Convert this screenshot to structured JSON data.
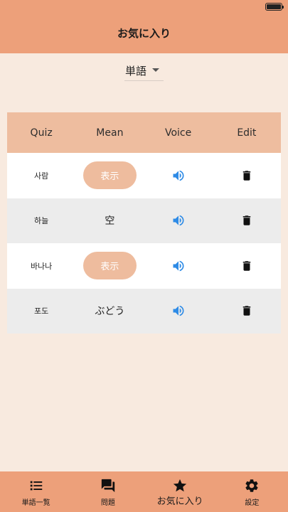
{
  "header": {
    "title": "お気に入り"
  },
  "filter": {
    "selected": "単語"
  },
  "table": {
    "columns": [
      "Quiz",
      "Mean",
      "Voice",
      "Edit"
    ],
    "rows": [
      {
        "quiz": "사람",
        "mean": "",
        "show_label": "表示"
      },
      {
        "quiz": "하늘",
        "mean": "空",
        "show_label": ""
      },
      {
        "quiz": "바나나",
        "mean": "",
        "show_label": "表示"
      },
      {
        "quiz": "포도",
        "mean": "ぶどう",
        "show_label": ""
      }
    ]
  },
  "nav": [
    {
      "label": "単語一覧",
      "icon": "list-icon"
    },
    {
      "label": "問題",
      "icon": "chat-icon"
    },
    {
      "label": "お気に入り",
      "icon": "star-icon",
      "active": true
    },
    {
      "label": "設定",
      "icon": "gear-icon"
    }
  ],
  "colors": {
    "header": "#eda07a",
    "background": "#f8eadf",
    "table_header": "#eebd9f",
    "show_button": "#eebc9e",
    "speaker": "#2e8be6"
  }
}
